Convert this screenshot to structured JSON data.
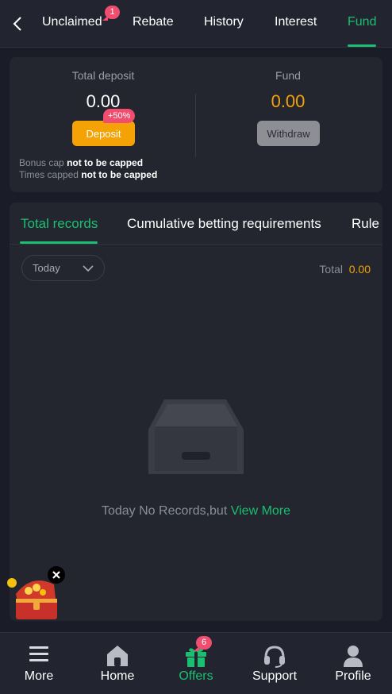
{
  "header": {
    "tabs": [
      {
        "label": "Unclaimed",
        "badge": "1"
      },
      {
        "label": "Rebate"
      },
      {
        "label": "History"
      },
      {
        "label": "Interest"
      },
      {
        "label": "Fund",
        "active": true
      }
    ]
  },
  "summary": {
    "total_deposit_label": "Total deposit",
    "total_deposit_value": "0.00",
    "deposit_button": "Deposit",
    "deposit_badge": "+50%",
    "fund_label": "Fund",
    "fund_value": "0.00",
    "withdraw_button": "Withdraw",
    "bonus_cap_label": "Bonus cap",
    "bonus_cap_value": "not to be capped",
    "times_capped_label": "Times capped",
    "times_capped_value": "not to be capped"
  },
  "records": {
    "tabs": [
      {
        "label": "Total records",
        "active": true
      },
      {
        "label": "Cumulative betting requirements"
      },
      {
        "label": "Rule"
      }
    ],
    "date_filter": "Today",
    "total_label": "Total",
    "total_value": "0.00",
    "empty_text": "Today No Records,but",
    "empty_link": "View More"
  },
  "bottom_nav": {
    "items": [
      {
        "label": "More",
        "icon": "menu-icon"
      },
      {
        "label": "Home",
        "icon": "home-icon"
      },
      {
        "label": "Offers",
        "icon": "gift-icon",
        "badge": "6",
        "active": true
      },
      {
        "label": "Support",
        "icon": "headset-icon"
      },
      {
        "label": "Profile",
        "icon": "user-icon"
      }
    ]
  },
  "colors": {
    "accent": "#1bbf72",
    "orange": "#f5a206",
    "badge": "#f04d6f",
    "background": "#1a1d27",
    "card": "#23262f"
  }
}
